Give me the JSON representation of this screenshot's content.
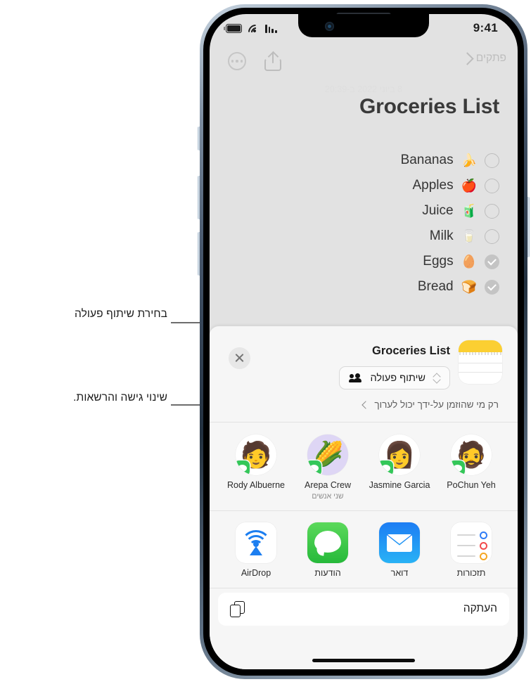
{
  "annotations": {
    "collaboration_callout": "בחירת שיתוף פעולה",
    "access_callout": "שינוי גישה והרשאות."
  },
  "status_bar": {
    "time": "9:41",
    "battery_icon": "battery-icon",
    "wifi_icon": "wifi-icon",
    "cellular_icon": "cellular-bars-icon"
  },
  "note_toolbar": {
    "back_label": "פתקים",
    "back_chevron_icon": "chevron-right-icon",
    "share_icon": "share-icon",
    "more_icon": "more-ellipsis-icon"
  },
  "note": {
    "date": "8 ביוני 2022 ב-20:39",
    "title": "Groceries List",
    "items": [
      {
        "label": "Bananas",
        "emoji": "🍌",
        "checked": false
      },
      {
        "label": "Apples",
        "emoji": "🍎",
        "checked": false
      },
      {
        "label": "Juice",
        "emoji": "🧃",
        "checked": false
      },
      {
        "label": "Milk",
        "emoji": "🥛",
        "checked": false
      },
      {
        "label": "Eggs",
        "emoji": "🥚",
        "checked": true
      },
      {
        "label": "Bread",
        "emoji": "🍞",
        "checked": true
      }
    ]
  },
  "share_sheet": {
    "close_icon": "close-icon",
    "doc_title": "Groceries List",
    "app_icon": "notes-app-icon",
    "collaboration_button": {
      "label": "שיתוף פעולה",
      "people_icon": "people-icon",
      "updown_icon": "chevron-up-down-icon"
    },
    "permission_row": {
      "text": "רק מי שהוזמן על-ידך יכול לערוך",
      "chevron_icon": "chevron-left-icon"
    },
    "contacts": [
      {
        "name": "PoChun Yeh",
        "sub": "",
        "avatar": "memoji-beard",
        "emoji": "🧔",
        "badge": "messages-badge"
      },
      {
        "name": "Jasmine Garcia",
        "sub": "",
        "avatar": "memoji-glasses",
        "emoji": "👩",
        "badge": "messages-badge"
      },
      {
        "name": "Arepa Crew",
        "sub": "שני אנשים",
        "avatar": "group-corn",
        "emoji": "🌽",
        "badge": "messages-badge"
      },
      {
        "name": "Rody Albuerne",
        "sub": "",
        "avatar": "memoji-beanie",
        "emoji": "🧑",
        "badge": "messages-badge"
      }
    ],
    "apps": [
      {
        "name": "תזכורות",
        "icon": "reminders-app-icon"
      },
      {
        "name": "דואר",
        "icon": "mail-app-icon"
      },
      {
        "name": "הודעות",
        "icon": "messages-app-icon"
      },
      {
        "name": "AirDrop",
        "icon": "airdrop-icon"
      }
    ],
    "actions": [
      {
        "label": "העתקה",
        "icon": "copy-icon"
      }
    ]
  },
  "colors": {
    "screen_bg": "#e2e2e2",
    "sheet_bg": "#f6f6f6",
    "notes_yellow": "#fbcf32",
    "messages_green": "#34c759",
    "airdrop_blue": "#1c7ef0"
  }
}
